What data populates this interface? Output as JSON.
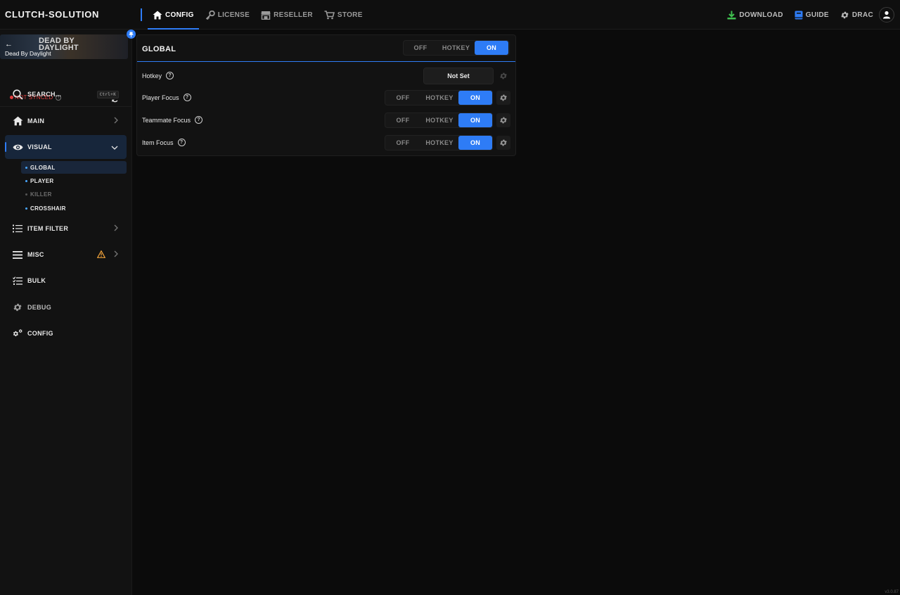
{
  "app": {
    "brand": "CLUTCH-SOLUTION",
    "version": "v3.0.87"
  },
  "nav": {
    "items": [
      {
        "label": "CONFIG",
        "icon": "home-icon",
        "active": true
      },
      {
        "label": "LICENSE",
        "icon": "key-icon",
        "active": false
      },
      {
        "label": "RESELLER",
        "icon": "store-icon",
        "active": false
      },
      {
        "label": "STORE",
        "icon": "cart-icon",
        "active": false
      }
    ]
  },
  "top_right": {
    "download": "DOWNLOAD",
    "guide": "GUIDE",
    "user": "DRAC"
  },
  "game": {
    "logo_line1": "DEAD BY",
    "logo_line2": "DAYLIGHT",
    "name": "Dead By Daylight",
    "sync_status": "NOT SYNCED"
  },
  "sidebar": {
    "search_label": "SEARCH...",
    "search_shortcut": "Ctrl+K",
    "items": [
      {
        "label": "MAIN",
        "icon": "home-icon"
      },
      {
        "label": "VISUAL",
        "icon": "eye-icon",
        "expanded": true
      },
      {
        "label": "ITEM FILTER",
        "icon": "list-icon"
      },
      {
        "label": "MISC",
        "icon": "menu-icon",
        "warning": true
      },
      {
        "label": "BULK",
        "icon": "checklist-icon"
      },
      {
        "label": "DEBUG",
        "icon": "gear-icon"
      },
      {
        "label": "CONFIG",
        "icon": "gears-icon"
      }
    ],
    "sub_items": [
      {
        "label": "GLOBAL",
        "active": true
      },
      {
        "label": "PLAYER",
        "active": false
      },
      {
        "label": "KILLER",
        "active": false,
        "disabled": true
      },
      {
        "label": "CROSSHAIR",
        "active": false
      }
    ]
  },
  "panel": {
    "title": "GLOBAL",
    "header_toggle": {
      "off": "OFF",
      "hotkey": "HOTKEY",
      "on": "ON",
      "selected": "ON"
    },
    "hotkey_row": {
      "label": "Hotkey",
      "value": "Not Set"
    },
    "rows": [
      {
        "label": "Player Focus",
        "off": "OFF",
        "hotkey": "HOTKEY",
        "on": "ON",
        "selected": "ON"
      },
      {
        "label": "Teammate Focus",
        "off": "OFF",
        "hotkey": "HOTKEY",
        "on": "ON",
        "selected": "ON"
      },
      {
        "label": "Item Focus",
        "off": "OFF",
        "hotkey": "HOTKEY",
        "on": "ON",
        "selected": "ON"
      }
    ]
  },
  "colors": {
    "accent": "#2e7cf6",
    "danger": "#e33b3b",
    "warning": "#f0a23a",
    "download_green": "#3fbf4f"
  }
}
